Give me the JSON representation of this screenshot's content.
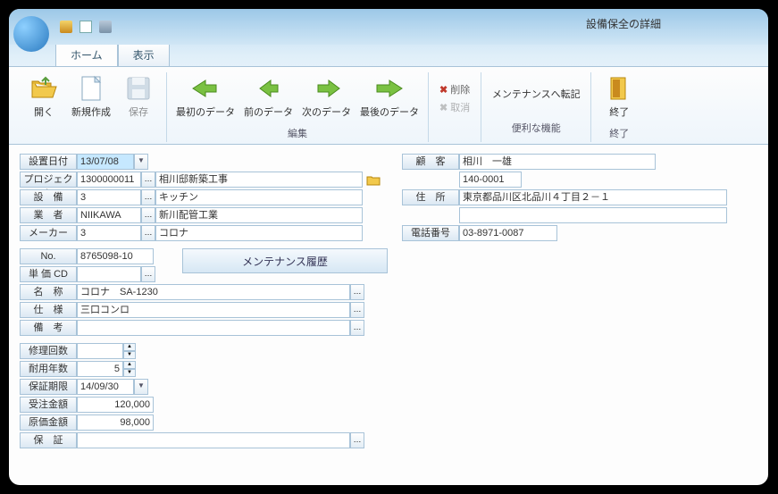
{
  "window": {
    "title": "設備保全の詳細"
  },
  "tabs": {
    "home": "ホーム",
    "view": "表示"
  },
  "ribbon": {
    "open": "開く",
    "new": "新規作成",
    "save": "保存",
    "first": "最初のデータ",
    "prev": "前のデータ",
    "next": "次のデータ",
    "last": "最後のデータ",
    "delete": "削除",
    "cancel": "取消",
    "transfer": "メンテナンスへ転記",
    "exit": "終了",
    "group_edit": "編集",
    "group_useful": "便利な機能",
    "group_exit": "終了"
  },
  "labels": {
    "install_date": "設置日付",
    "project": "プロジェクト",
    "equipment": "設　備",
    "vendor": "業　者",
    "maker": "メーカー",
    "no": "No.",
    "unitcd": "単 価 CD",
    "name": "名　称",
    "spec": "仕　様",
    "remarks": "備　考",
    "repairs": "修理回数",
    "lifespan": "耐用年数",
    "warranty": "保証期限",
    "order_amt": "受注金額",
    "cost_amt": "原価金額",
    "guarantee": "保　証",
    "customer": "顧　客",
    "address": "住　所",
    "phone": "電話番号",
    "maint_btn": "メンテナンス履歴"
  },
  "values": {
    "install_date": "13/07/08",
    "project_code": "1300000011",
    "project_name": "相川邸新築工事",
    "equipment_code": "3",
    "equipment_name": "キッチン",
    "vendor_code": "NIIKAWA",
    "vendor_name": "新川配管工業",
    "maker_code": "3",
    "maker_name": "コロナ",
    "no": "8765098-10",
    "unitcd": "",
    "name": "コロナ　SA-1230",
    "spec": "三口コンロ",
    "remarks": "",
    "repairs": "",
    "lifespan": "5",
    "warranty": "14/09/30",
    "order_amt": "120,000",
    "cost_amt": "98,000",
    "guarantee": "",
    "customer": "相川　一雄",
    "postal": "140-0001",
    "address": "東京都品川区北品川４丁目２－１",
    "phone": "03-8971-0087"
  }
}
